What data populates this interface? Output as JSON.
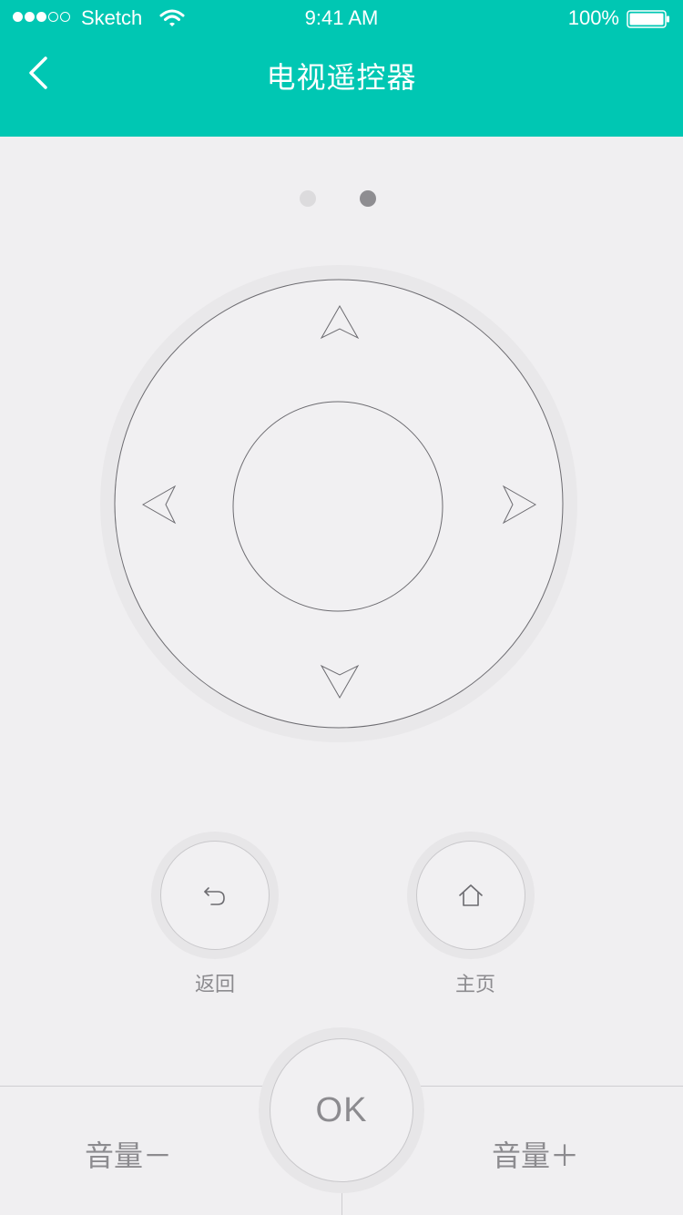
{
  "status_bar": {
    "carrier": "Sketch",
    "time": "9:41 AM",
    "battery": "100%"
  },
  "nav": {
    "title": "电视遥控器"
  },
  "pager": {
    "count": 2,
    "active_index": 1
  },
  "buttons": {
    "back_label": "返回",
    "home_label": "主页",
    "ok_label": "OK",
    "volume_down_label": "音量－",
    "volume_up_label": "音量＋"
  },
  "icons": {
    "back_nav": "chevron-left-icon",
    "dpad_up": "arrow-up-icon",
    "dpad_down": "arrow-down-icon",
    "dpad_left": "arrow-left-icon",
    "dpad_right": "arrow-right-icon",
    "return": "undo-icon",
    "home": "home-icon"
  },
  "colors": {
    "header": "#00c7b3",
    "background": "#f0eff1",
    "text_muted": "#8c8b8f"
  }
}
